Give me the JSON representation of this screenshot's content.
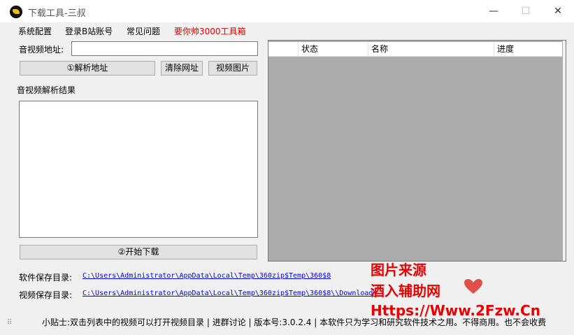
{
  "window": {
    "title": "下载工具-三叔",
    "minimize_glyph": "—",
    "maximize_glyph": "☐",
    "close_glyph": "✕"
  },
  "menu": {
    "items": [
      "系统配置",
      "登录B站账号",
      "常见问题"
    ],
    "highlight": "要你帅3000工具箱",
    "highlight_color": "#e00000"
  },
  "url_section": {
    "label": "音视频地址:",
    "value": ""
  },
  "buttons": {
    "parse": "①解析地址",
    "clear": "清除网址",
    "video_image": "视频图片",
    "start": "②开始下载"
  },
  "results": {
    "label": "音视频解析结果"
  },
  "table": {
    "columns": [
      "",
      "状态",
      "名称",
      "进度"
    ]
  },
  "paths": {
    "software_label": "软件保存目录:",
    "software_path": "C:\\Users\\Administrator\\AppData\\Local\\Temp\\360zip$Temp\\360$8",
    "video_label": "视频保存目录:",
    "video_path": "C:\\Users\\Administrator\\AppData\\Local\\Temp\\360zip$Temp\\360$8\\\\Download\\"
  },
  "status_bar": {
    "text": "小贴士:双击列表中的视频可以打开视频目录 | 进群讨论 | 版本号:3.0.2.4 | 本软件只为学习和研究软件技术之用。不得商用。也不会收费"
  },
  "watermark": {
    "line1": "图片来源",
    "line2": "酒入辅助网",
    "line3": "Https://Www.2Fzw.Cn"
  },
  "icons": {
    "app": "app-logo-icon",
    "grip": "resize-grip-icon",
    "heart": "heart-icon"
  }
}
